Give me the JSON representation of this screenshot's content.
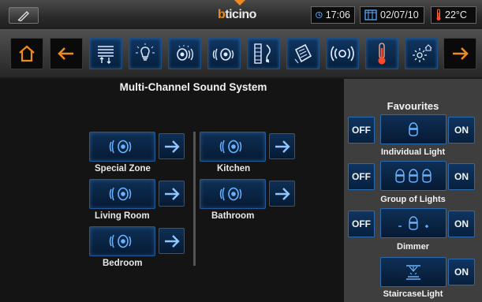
{
  "status_bar": {
    "logo_prefix": "b",
    "logo_rest": "ticino",
    "time": "17:06",
    "date": "02/07/10",
    "temperature": "22°C",
    "accent_color": "#f08a1c"
  },
  "toolbar": {
    "icons": [
      "home-icon",
      "back-arrow-icon",
      "automation-icon",
      "light-bulb-icon",
      "sound-icon",
      "sound-zones-icon",
      "music-icon",
      "scenario-icon",
      "radio-icon",
      "thermometer-icon",
      "energy-icon",
      "forward-arrow-icon"
    ]
  },
  "main": {
    "title": "Multi-Channel Sound System",
    "zones": [
      {
        "label": "Special Zone"
      },
      {
        "label": "Living Room"
      },
      {
        "label": "Bedroom"
      },
      {
        "label": "Kitchen"
      },
      {
        "label": "Bathroom"
      }
    ]
  },
  "favourites": {
    "title": "Favourites",
    "off_label": "OFF",
    "on_label": "ON",
    "items": [
      {
        "label": "Individual Light",
        "icon": "single-light-icon"
      },
      {
        "label": "Group of Lights",
        "icon": "group-lights-icon"
      },
      {
        "label": "Dimmer",
        "icon": "dimmer-icon"
      },
      {
        "label": "StaircaseLight",
        "icon": "staircase-light-icon"
      }
    ]
  }
}
